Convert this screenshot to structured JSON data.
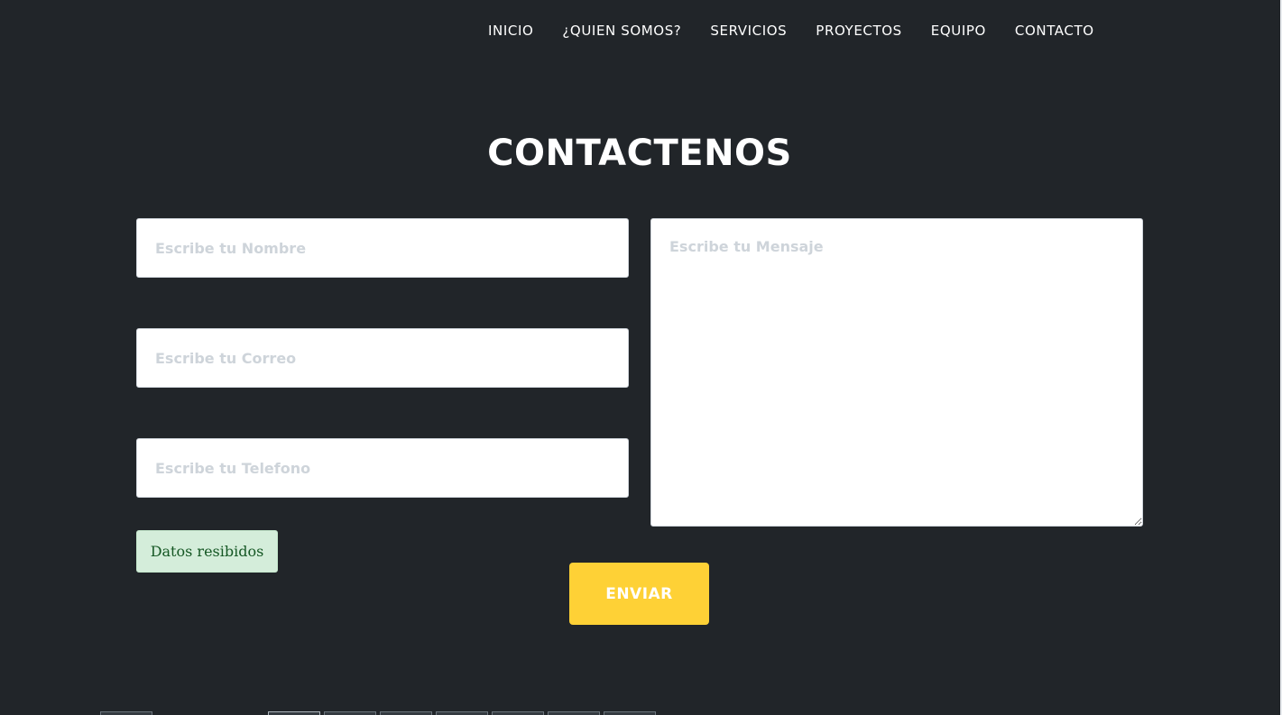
{
  "nav": {
    "items": [
      {
        "label": "INICIO"
      },
      {
        "label": "¿QUIEN SOMOS?"
      },
      {
        "label": "SERVICIOS"
      },
      {
        "label": "PROYECTOS"
      },
      {
        "label": "EQUIPO"
      },
      {
        "label": "CONTACTO"
      }
    ]
  },
  "contact": {
    "title": "CONTACTENOS",
    "name_placeholder": "Escribe tu Nombre",
    "email_placeholder": "Escribe tu Correo",
    "phone_placeholder": "Escribe tu Telefono",
    "message_placeholder": "Escribe tu Mensaje",
    "alert_text": "Datos resibidos",
    "submit_label": "ENVIAR"
  },
  "colors": {
    "background": "#212529",
    "accent": "#fed136",
    "success_bg": "#d4edda",
    "success_text": "#155724"
  }
}
